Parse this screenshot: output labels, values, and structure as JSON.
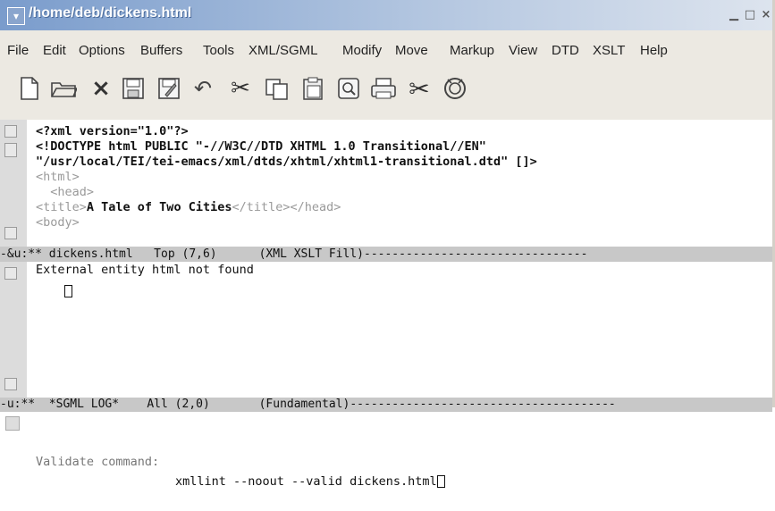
{
  "window": {
    "title": "/home/deb/dickens.html",
    "sysmenu_icon": "chevron-down-icon",
    "controls": [
      "minimize-icon",
      "maximize-icon",
      "close-icon"
    ]
  },
  "menubar": [
    "File",
    "Edit",
    "Options",
    "Buffers",
    "Tools",
    "XML/SGML",
    "Modify",
    "Move",
    "Markup",
    "View",
    "DTD",
    "XSLT",
    "Help"
  ],
  "toolbar": [
    {
      "name": "new-file-icon"
    },
    {
      "name": "open-folder-icon"
    },
    {
      "name": "close-buffer-icon",
      "glyph": "×"
    },
    {
      "name": "save-icon"
    },
    {
      "name": "save-as-icon"
    },
    {
      "name": "undo-icon"
    },
    {
      "name": "cut-icon"
    },
    {
      "name": "copy-icon"
    },
    {
      "name": "paste-icon"
    },
    {
      "name": "search-icon"
    },
    {
      "name": "print-icon"
    },
    {
      "name": "customize-icon"
    },
    {
      "name": "help-icon"
    }
  ],
  "editor": {
    "lines": [
      {
        "text": "<?xml version=\"1.0\"?>",
        "style": "bold"
      },
      {
        "text": "<!DOCTYPE html PUBLIC \"-//W3C//DTD XHTML 1.0 Transitional//EN\"",
        "style": "bold"
      },
      {
        "text": "\"/usr/local/TEI/tei-emacs/xml/dtds/xhtml/xhtml1-transitional.dtd\" []>",
        "style": "bold"
      },
      {
        "text": "<html>",
        "style": "tag"
      },
      {
        "text": "  <head>",
        "style": "tag"
      }
    ],
    "title_line": {
      "open": "<title>",
      "content": "A Tale of Two Cities",
      "close": "</title></head>"
    },
    "last_line": "<body>"
  },
  "modeline1": "-&u:** dickens.html   Top (7,6)      (XML XSLT Fill)--------------------------------",
  "log": {
    "message": "External entity html not found"
  },
  "modeline2": "-u:**  *SGML LOG*    All (2,0)       (Fundamental)--------------------------------------",
  "minibuffer": {
    "prompt": "Validate command:",
    "value": "xmllint --noout --valid dickens.html"
  },
  "colors": {
    "titlebar_start": "#7a9ccc",
    "modeline": "#c8c8c8"
  }
}
